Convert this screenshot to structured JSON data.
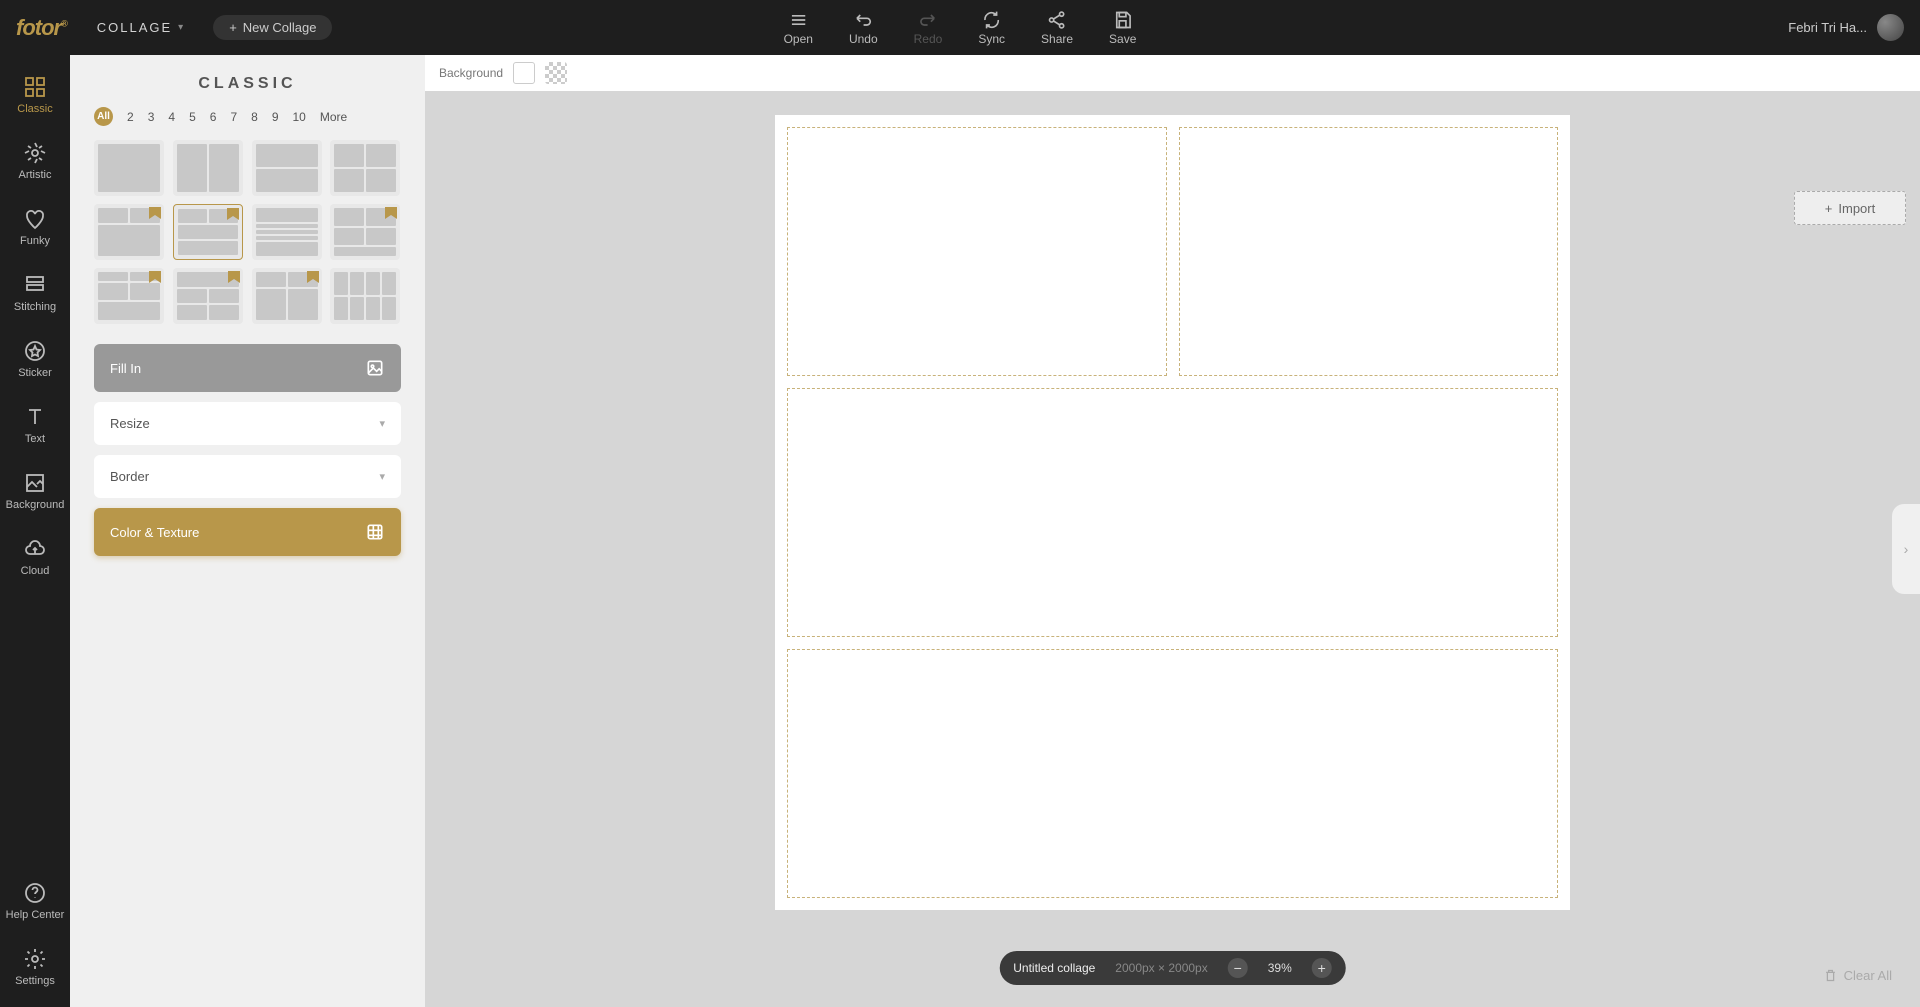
{
  "header": {
    "logo": "fotor",
    "mode": "COLLAGE",
    "newCollage": "New Collage",
    "actions": {
      "open": "Open",
      "undo": "Undo",
      "redo": "Redo",
      "sync": "Sync",
      "share": "Share",
      "save": "Save"
    },
    "username": "Febri Tri Ha..."
  },
  "rail": {
    "classic": "Classic",
    "artistic": "Artistic",
    "funky": "Funky",
    "stitching": "Stitching",
    "sticker": "Sticker",
    "text": "Text",
    "background": "Background",
    "cloud": "Cloud",
    "help": "Help Center",
    "settings": "Settings"
  },
  "panel": {
    "title": "CLASSIC",
    "filters": {
      "all": "All",
      "f2": "2",
      "f3": "3",
      "f4": "4",
      "f5": "5",
      "f6": "6",
      "f7": "7",
      "f8": "8",
      "f9": "9",
      "f10": "10",
      "more": "More"
    },
    "controls": {
      "fillIn": "Fill In",
      "resize": "Resize",
      "border": "Border",
      "colorTexture": "Color & Texture"
    }
  },
  "bgBar": {
    "label": "Background"
  },
  "importBtn": "Import",
  "bottom": {
    "title": "Untitled collage",
    "dimensions": "2000px × 2000px",
    "zoom": "39%",
    "clearAll": "Clear All"
  }
}
